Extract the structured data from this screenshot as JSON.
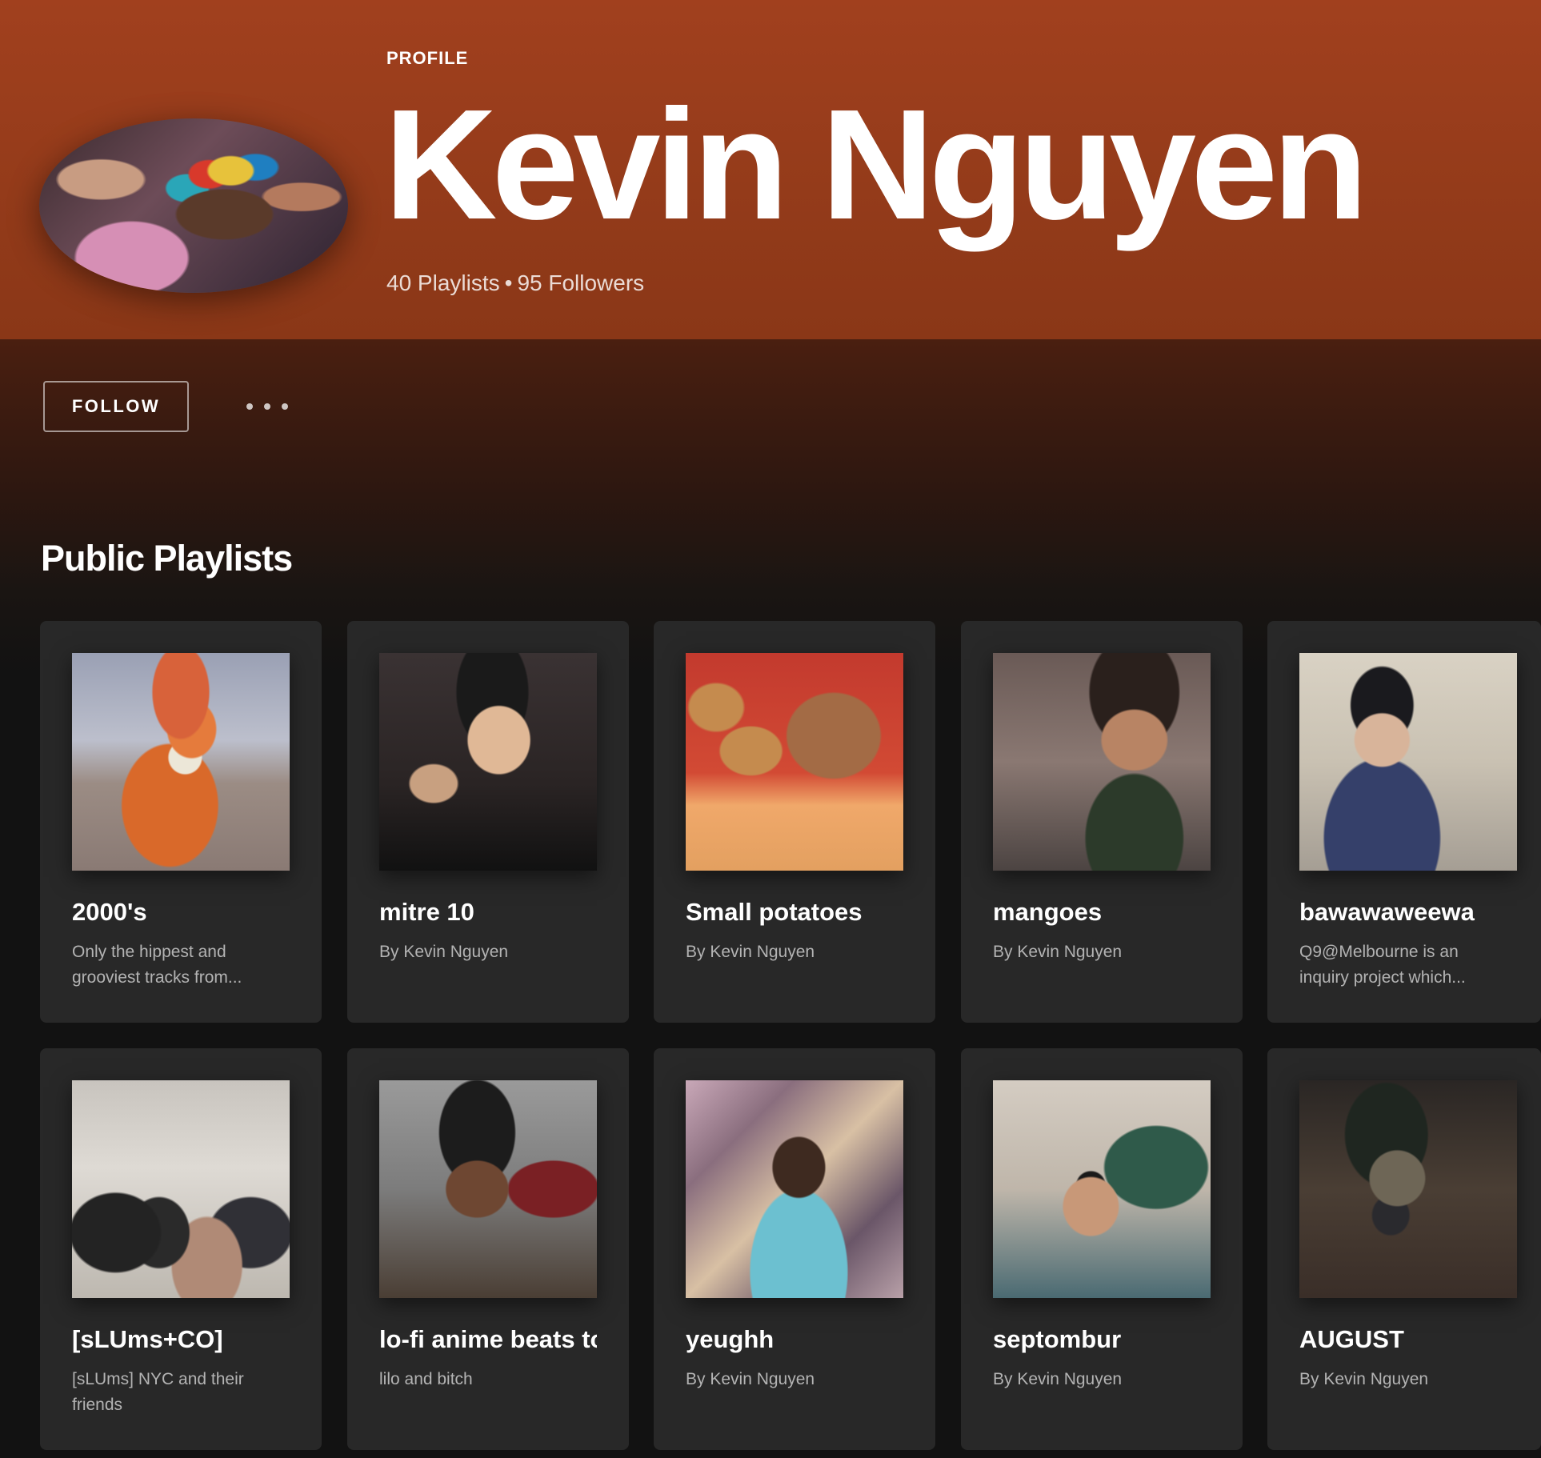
{
  "profile": {
    "label": "PROFILE",
    "name": "Kevin Nguyen",
    "playlists_count": "40 Playlists",
    "separator": "•",
    "followers_count": "95 Followers"
  },
  "actions": {
    "follow_label": "FOLLOW",
    "more_icon": "more-horizontal-icon"
  },
  "section": {
    "title": "Public Playlists"
  },
  "playlists": [
    {
      "title": "2000's",
      "subtitle": "Only the hippest and grooviest tracks from..."
    },
    {
      "title": "mitre 10",
      "subtitle": "By Kevin Nguyen"
    },
    {
      "title": "Small potatoes",
      "subtitle": "By Kevin Nguyen"
    },
    {
      "title": "mangoes",
      "subtitle": "By Kevin Nguyen"
    },
    {
      "title": "bawawaweewa",
      "subtitle": "Q9@Melbourne is an inquiry project which..."
    },
    {
      "title": "[sLUms+CO]",
      "subtitle": "[sLUms] NYC and their friends"
    },
    {
      "title": "lo-fi anime beats to",
      "subtitle": "lilo and bitch"
    },
    {
      "title": "yeughh",
      "subtitle": "By Kevin Nguyen"
    },
    {
      "title": "septombur",
      "subtitle": "By Kevin Nguyen"
    },
    {
      "title": "AUGUST",
      "subtitle": "By Kevin Nguyen"
    }
  ]
}
